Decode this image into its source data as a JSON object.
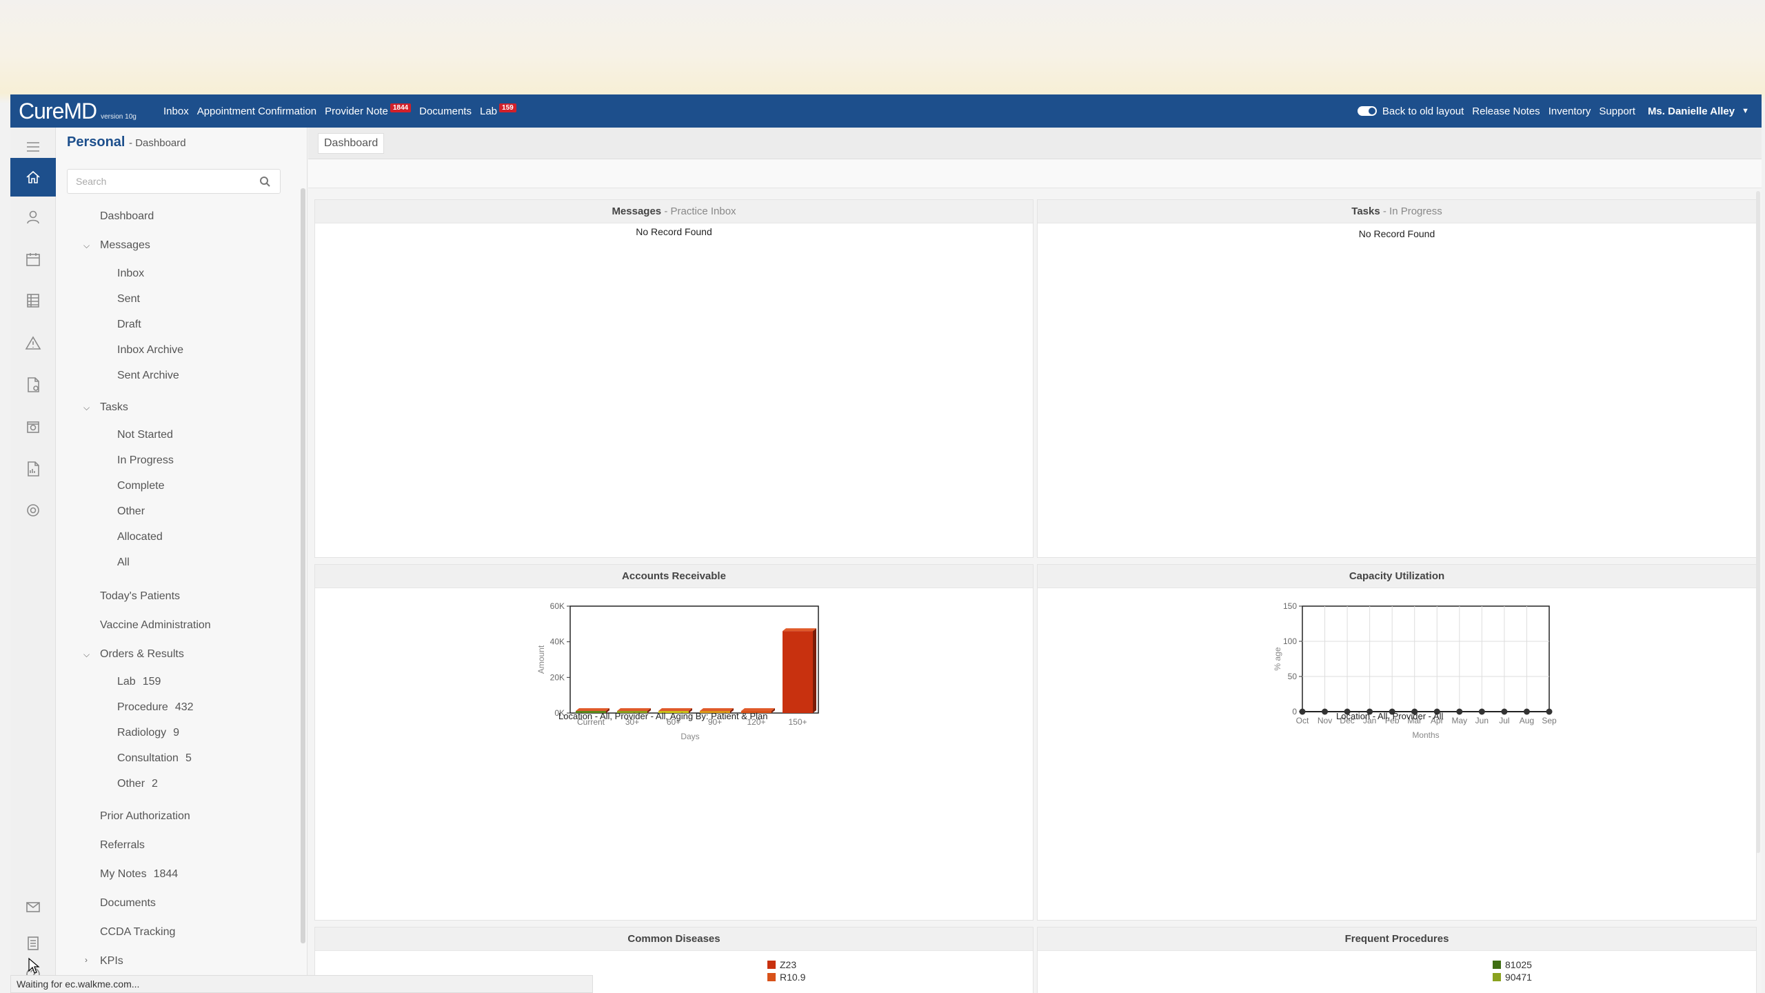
{
  "topbar": {
    "logo_main": "CureMD",
    "logo_version": "version 10g",
    "nav": [
      {
        "label": "Inbox",
        "badge": ""
      },
      {
        "label": "Appointment Confirmation",
        "badge": ""
      },
      {
        "label": "Provider Note",
        "badge": "1844"
      },
      {
        "label": "Documents",
        "badge": ""
      },
      {
        "label": "Lab",
        "badge": "159"
      }
    ],
    "back_to_old": "Back to old layout",
    "release_notes": "Release Notes",
    "inventory": "Inventory",
    "support": "Support",
    "user": "Ms. Danielle Alley"
  },
  "sidebar": {
    "title": "Personal",
    "subtitle": "- Dashboard",
    "search_placeholder": "Search",
    "items": {
      "dashboard": "Dashboard",
      "messages": "Messages",
      "inbox": "Inbox",
      "sent": "Sent",
      "draft": "Draft",
      "inbox_archive": "Inbox Archive",
      "sent_archive": "Sent Archive",
      "tasks": "Tasks",
      "not_started": "Not Started",
      "in_progress": "In Progress",
      "complete": "Complete",
      "other": "Other",
      "allocated": "Allocated",
      "all": "All",
      "todays_patients": "Today's Patients",
      "vaccine_admin": "Vaccine Administration",
      "orders_results": "Orders & Results",
      "lab": "Lab",
      "lab_count": "159",
      "procedure": "Procedure",
      "procedure_count": "432",
      "radiology": "Radiology",
      "radiology_count": "9",
      "consultation": "Consultation",
      "consultation_count": "5",
      "orders_other": "Other",
      "orders_other_count": "2",
      "prior_auth": "Prior Authorization",
      "referrals": "Referrals",
      "my_notes": "My Notes",
      "my_notes_count": "1844",
      "documents": "Documents",
      "ccda": "CCDA Tracking",
      "kpis": "KPIs"
    }
  },
  "tab": {
    "dashboard": "Dashboard"
  },
  "panels": {
    "messages": {
      "title": "Messages",
      "sub": "- Practice Inbox",
      "empty": "No Record Found"
    },
    "tasks": {
      "title": "Tasks",
      "sub": "- In Progress",
      "empty": "No Record Found"
    },
    "ar": {
      "title": "Accounts Receivable",
      "footer": "Location - All, Provider - All, Aging By: Patient & Plan"
    },
    "capacity": {
      "title": "Capacity Utilization",
      "footer": "Location - All, Provider - All"
    },
    "diseases": {
      "title": "Common Diseases",
      "legend": [
        "Z23",
        "R10.9"
      ]
    },
    "procedures": {
      "title": "Frequent Procedures",
      "legend": [
        "81025",
        "90471"
      ]
    }
  },
  "colors": {
    "brand": "#1d4f8c",
    "badge": "#d2202a",
    "bar_red": "#c8310f"
  },
  "status_text": "Waiting for ec.walkme.com...",
  "chart_data": [
    {
      "type": "bar",
      "title": "Accounts Receivable",
      "xlabel": "Days",
      "ylabel": "Amount",
      "categories": [
        "Current",
        "30+",
        "60+",
        "90+",
        "120+",
        "150+"
      ],
      "values": [
        1000,
        1000,
        800,
        800,
        300,
        46000
      ],
      "colors": [
        "#5a8a1c",
        "#8aa21f",
        "#c9c21a",
        "#d99a1a",
        "#d8521a",
        "#c8310f"
      ],
      "yticks": [
        "0K",
        "20K",
        "40K",
        "60K"
      ],
      "ylim": [
        0,
        60000
      ]
    },
    {
      "type": "line",
      "title": "Capacity Utilization",
      "xlabel": "Months",
      "ylabel": "% age",
      "categories": [
        "Oct",
        "Nov",
        "Dec",
        "Jan",
        "Feb",
        "Mar",
        "Apr",
        "May",
        "Jun",
        "Jul",
        "Aug",
        "Sep"
      ],
      "values": [
        0,
        0,
        0,
        0,
        0,
        0,
        0,
        0,
        0,
        0,
        0,
        0
      ],
      "yticks": [
        "0",
        "50",
        "100",
        "150"
      ],
      "ylim": [
        0,
        150
      ],
      "grid": true
    }
  ]
}
